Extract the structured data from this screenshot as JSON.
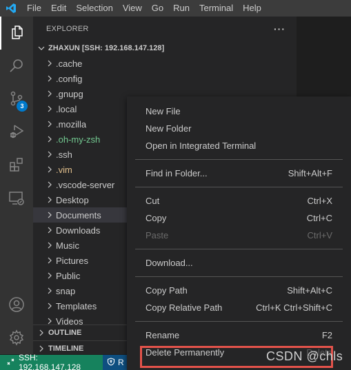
{
  "titlebar": {
    "logo": "vscode-logo",
    "menu": [
      "File",
      "Edit",
      "Selection",
      "View",
      "Go",
      "Run",
      "Terminal",
      "Help"
    ]
  },
  "activitybar": {
    "items": [
      {
        "icon": "files-icon",
        "active": true
      },
      {
        "icon": "search-icon"
      },
      {
        "icon": "source-control-icon",
        "badge": "3"
      },
      {
        "icon": "run-debug-icon"
      },
      {
        "icon": "extensions-icon"
      },
      {
        "icon": "remote-explorer-icon"
      }
    ],
    "bottom": [
      {
        "icon": "account-icon"
      },
      {
        "icon": "gear-icon"
      }
    ]
  },
  "sidebar": {
    "title": "EXPLORER",
    "more": "···",
    "workspace": "ZHAXUN [SSH: 192.168.147.128]",
    "tree": [
      {
        "label": ".cache"
      },
      {
        "label": ".config"
      },
      {
        "label": ".gnupg"
      },
      {
        "label": ".local"
      },
      {
        "label": ".mozilla"
      },
      {
        "label": ".oh-my-zsh",
        "status": "untracked"
      },
      {
        "label": ".ssh"
      },
      {
        "label": ".vim",
        "status": "modified"
      },
      {
        "label": ".vscode-server"
      },
      {
        "label": "Desktop"
      },
      {
        "label": "Documents",
        "selected": true
      },
      {
        "label": "Downloads"
      },
      {
        "label": "Music"
      },
      {
        "label": "Pictures"
      },
      {
        "label": "Public"
      },
      {
        "label": "snap"
      },
      {
        "label": "Templates"
      },
      {
        "label": "Videos"
      }
    ],
    "outline": "OUTLINE",
    "timeline": "TIMELINE"
  },
  "context_menu": {
    "groups": [
      [
        {
          "label": "New File",
          "shortcut": ""
        },
        {
          "label": "New Folder",
          "shortcut": ""
        },
        {
          "label": "Open in Integrated Terminal",
          "shortcut": ""
        }
      ],
      [
        {
          "label": "Find in Folder...",
          "shortcut": "Shift+Alt+F"
        }
      ],
      [
        {
          "label": "Cut",
          "shortcut": "Ctrl+X"
        },
        {
          "label": "Copy",
          "shortcut": "Ctrl+C"
        },
        {
          "label": "Paste",
          "shortcut": "Ctrl+V",
          "disabled": true
        }
      ],
      [
        {
          "label": "Download...",
          "shortcut": ""
        }
      ],
      [
        {
          "label": "Copy Path",
          "shortcut": "Shift+Alt+C"
        },
        {
          "label": "Copy Relative Path",
          "shortcut": "Ctrl+K Ctrl+Shift+C"
        }
      ],
      [
        {
          "label": "Rename",
          "shortcut": "F2"
        },
        {
          "label": "Delete Permanently",
          "shortcut": "Delete",
          "highlighted": true
        }
      ]
    ]
  },
  "statusbar": {
    "remote": "SSH: 192.168.147.128",
    "restricted": "R"
  },
  "watermark": "CSDN @chls",
  "colors": {
    "accent": "#007acc",
    "remote_bg": "#16825d",
    "highlight_box": "#e5534b",
    "untracked": "#73c991",
    "modified": "#e2c08d"
  }
}
